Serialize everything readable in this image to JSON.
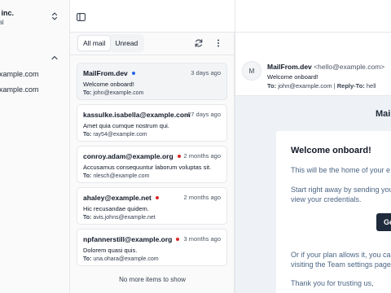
{
  "sidebar": {
    "org_name": "e inc.",
    "org_plan": "ual",
    "items": [
      {
        "label": "example.com"
      },
      {
        "label": "example.com"
      }
    ]
  },
  "list": {
    "tabs": [
      {
        "label": "All mail",
        "active": true
      },
      {
        "label": "Unread",
        "active": false
      }
    ],
    "to_label": "To:",
    "mails": [
      {
        "from": "MailFrom.dev",
        "dot_color": "#2563eb",
        "date": "3 days ago",
        "subject": "Welcome onboard!",
        "to": "john@example.com"
      },
      {
        "from": "kassulke.isabella@example.com",
        "dot_color": "",
        "date": "27 days ago",
        "subject": "Amet quia cumque nostrum qui.",
        "to": "ray54@example.com"
      },
      {
        "from": "conroy.adam@example.org",
        "dot_color": "#dc2626",
        "date": "2 months ago",
        "subject": "Accusamus consequuntur laborum voluptas sit.",
        "to": "nlesch@example.com"
      },
      {
        "from": "ahaley@example.net",
        "dot_color": "#dc2626",
        "date": "2 months ago",
        "subject": "Hic recusandae quidem.",
        "to": "avis.johns@example.net"
      },
      {
        "from": "npfannerstill@example.org",
        "dot_color": "#dc2626",
        "date": "3 months ago",
        "subject": "Dolorem quasi quis.",
        "to": "una.ohara@example.com"
      }
    ],
    "no_more": "No more items to show"
  },
  "reader": {
    "avatar_initial": "M",
    "from_name": "MailFrom.dev",
    "from_email": "<hello@example.com>",
    "subject": "Welcome onboard!",
    "to_label": "To:",
    "to": "john@example.com",
    "separator": "|",
    "reply_to_label": "Reply-To:",
    "reply_to": "hell",
    "brand": "Mail",
    "email_title": "Welcome onboard!",
    "p1": "This will be the home of your e",
    "p2_line1": "Start right away by sending you",
    "p2_line2": "view your credentials.",
    "cta": "Ge",
    "p3_line1": "Or if your plan allows it, you ca",
    "p3_line2": "visiting the Team settings page.",
    "p4": "Thank you for trusting us,"
  },
  "colors": {
    "flag": "#f59e0b",
    "eye": "#2563eb",
    "trash": "#ef4444",
    "cta_bg": "#1f2a3c"
  }
}
